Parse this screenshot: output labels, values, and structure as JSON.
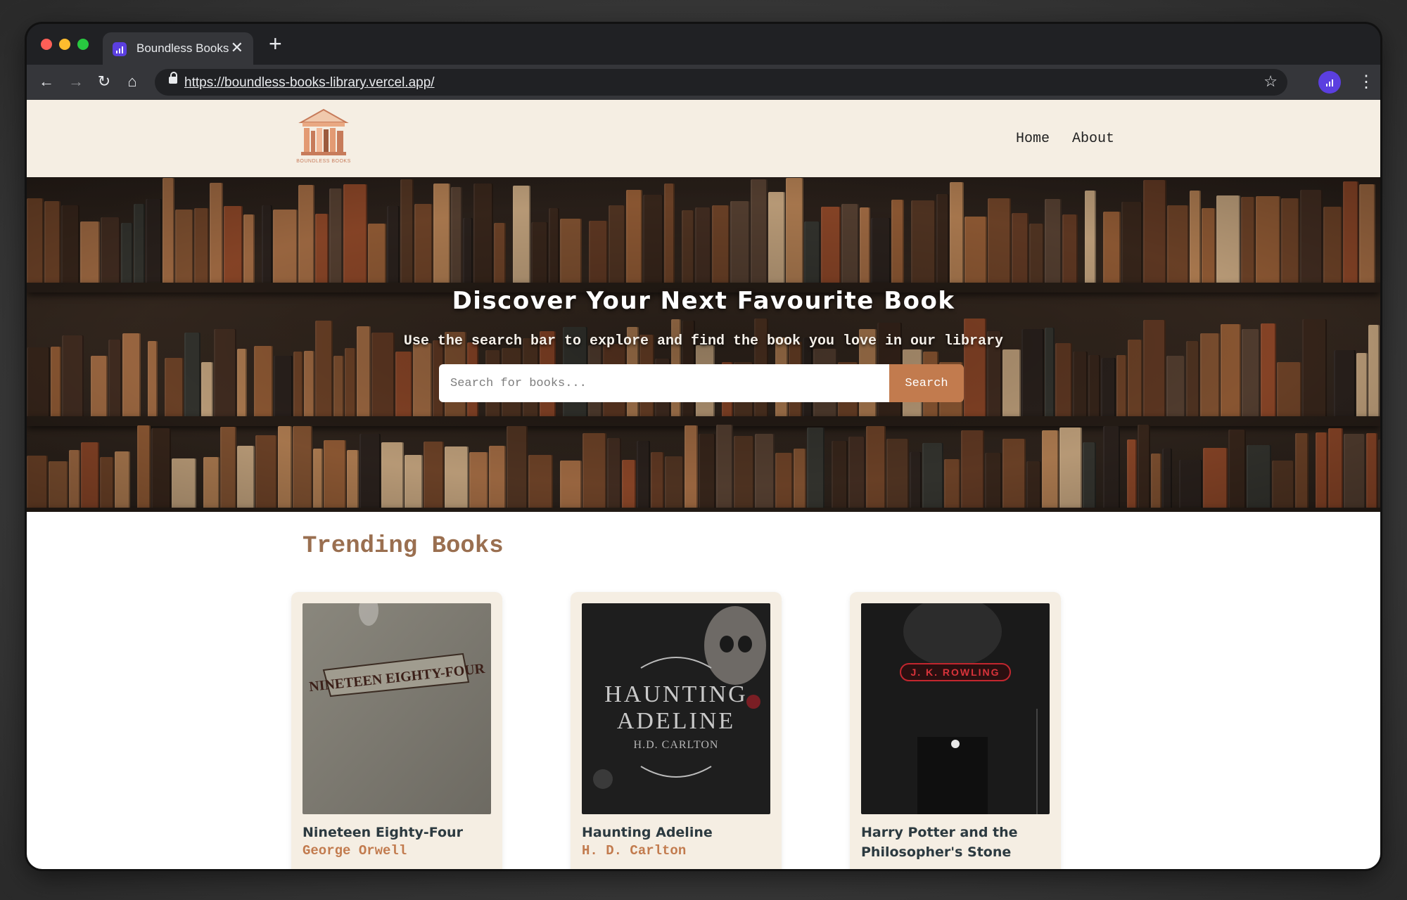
{
  "browser": {
    "tab_title": "Boundless Books",
    "tab_close": "✕",
    "new_tab": "+",
    "url": "https://boundless-books-library.vercel.app/",
    "icons": {
      "back": "←",
      "forward": "→",
      "reload": "↻",
      "home": "⌂",
      "star": "☆",
      "menu": "⋮"
    }
  },
  "header": {
    "logo_text": "BOUNDLESS BOOKS",
    "nav": [
      "Home",
      "About"
    ]
  },
  "hero": {
    "title": "Discover Your Next Favourite Book",
    "subtitle": "Use the search bar to explore and find the book you love in our library",
    "search_placeholder": "Search for books...",
    "search_button": "Search"
  },
  "trending": {
    "title": "Trending Books",
    "books": [
      {
        "title": "Nineteen Eighty-Four",
        "author": "George Orwell",
        "cover_text": "NINETEEN EIGHTY-FOUR"
      },
      {
        "title": "Haunting Adeline",
        "author": "H. D. Carlton",
        "cover_text_1": "HAUNTING",
        "cover_text_2": "ADELINE",
        "cover_text_3": "H.D. CARLTON"
      },
      {
        "title": "Harry Potter and the Philosopher's Stone",
        "author": "",
        "cover_text": "J. K. ROWLING"
      }
    ]
  },
  "colors": {
    "accent": "#c27b4e",
    "header_bg": "#f5eee3",
    "section_title": "#9a6f50",
    "browser_accent": "#5b3fe0"
  }
}
